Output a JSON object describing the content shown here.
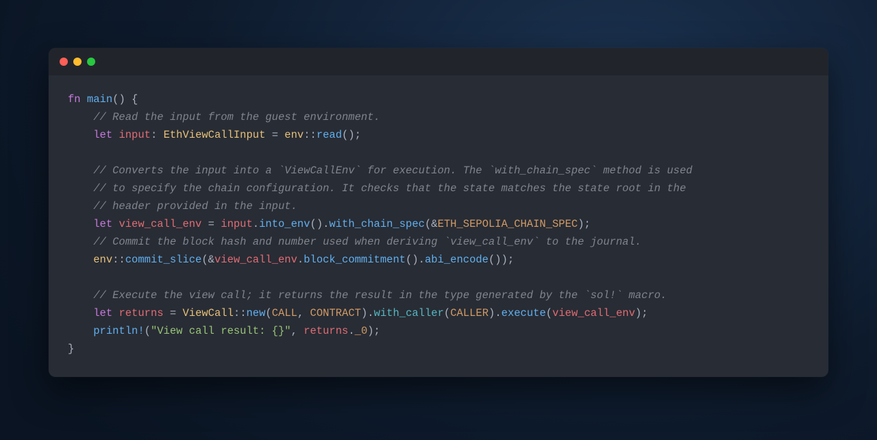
{
  "window": {
    "traffic_lights": [
      "close",
      "minimize",
      "zoom"
    ]
  },
  "code": {
    "l1": {
      "kw_fn": "fn",
      "main": "main",
      "open": "() {"
    },
    "l2": {
      "comment": "// Read the input from the guest environment."
    },
    "l3": {
      "kw_let": "let",
      "input": "input",
      "colon": ": ",
      "type": "EthViewCallInput",
      "eq": " = ",
      "env": "env",
      "dd": "::",
      "read": "read",
      "tail": "();"
    },
    "l5": {
      "comment": "// Converts the input into a `ViewCallEnv` for execution. The `with_chain_spec` method is used"
    },
    "l6": {
      "comment": "// to specify the chain configuration. It checks that the state matches the state root in the"
    },
    "l7": {
      "comment": "// header provided in the input."
    },
    "l8": {
      "kw_let": "let",
      "vce": "view_call_env",
      "eq": " = ",
      "input": "input",
      "dot1": ".",
      "into_env": "into_env",
      "p1": "().",
      "wcs": "with_chain_spec",
      "open": "(",
      "amp": "&",
      "const": "ETH_SEPOLIA_CHAIN_SPEC",
      "close": ");"
    },
    "l9": {
      "comment": "// Commit the block hash and number used when deriving `view_call_env` to the journal."
    },
    "l10": {
      "env": "env",
      "dd": "::",
      "cs": "commit_slice",
      "open": "(",
      "amp": "&",
      "vce": "view_call_env",
      "dot1": ".",
      "bc": "block_commitment",
      "p1": "().",
      "ae": "abi_encode",
      "tail": "());"
    },
    "l12": {
      "comment": "// Execute the view call; it returns the result in the type generated by the `sol!` macro."
    },
    "l13": {
      "kw_let": "let",
      "returns": "returns",
      "eq": " = ",
      "ViewCall": "ViewCall",
      "dd": "::",
      "new": "new",
      "open": "(",
      "CALL": "CALL",
      "comma": ", ",
      "CONTRACT": "CONTRACT",
      "close_dot": ").",
      "with_caller": "with_caller",
      "open2": "(",
      "CALLER": "CALLER",
      "close2_dot": ").",
      "execute": "execute",
      "open3": "(",
      "vce": "view_call_env",
      "tail": ");"
    },
    "l14": {
      "println": "println!",
      "open": "(",
      "str": "\"View call result: {}\"",
      "comma": ", ",
      "returns": "returns",
      "dot": ".",
      "_0": "_0",
      "tail": ");"
    },
    "l15": {
      "brace": "}"
    }
  }
}
